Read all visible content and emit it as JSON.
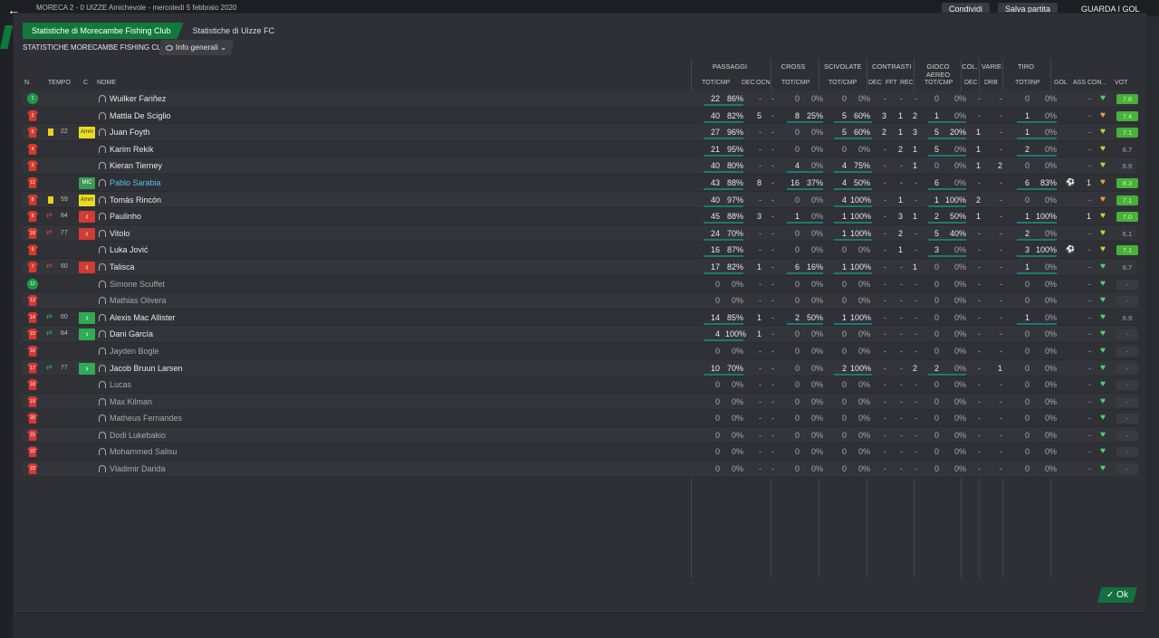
{
  "top": {
    "match_title": "MORECA  2 - 0  UIZZE  Amichevole - mercoledì 5 febbraio 2020",
    "share": "Condividi",
    "save": "Salva partita",
    "goals": "GUARDA I GOL"
  },
  "tabs": [
    "Statistiche di Morecambe Fishing Club",
    "Statistiche di Uizze FC"
  ],
  "subtitle": "STATISTICHE MORECAMBE FISHING CLUB",
  "dropdown": "Info generali",
  "groups": {
    "passaggi": "PASSAGGI",
    "cross": "CROSS",
    "scivolate": "SCIVOLATE",
    "contrasti": "CONTRASTI",
    "gioco_aereo": "GIOCO AEREO",
    "col": "COL.",
    "varie": "VARIE",
    "tiro": "TIRO"
  },
  "headers": {
    "n": "N.",
    "tempo": "TEMPO",
    "c": "C",
    "nome": "NOME",
    "tot_cmp1": "TOT/CMP",
    "dec": "DEC",
    "ocn": "OCN",
    "tot_cmp2": "TOT/CMP",
    "tot_cmp3": "TOT/CMP",
    "dec2": "DEC",
    "fft": "FFT",
    "rec": "REC",
    "tot_cmp4": "TOT/CMP",
    "dec3": "DEC",
    "drb": "DRB",
    "tot_inp": "TOT/INP",
    "gol": "GOL",
    "ass": "ASS",
    "con": "CON...",
    "vot": "VOT"
  },
  "players": [
    {
      "n": "1",
      "gk": true,
      "ev": "",
      "min": "",
      "badge": "",
      "name": "Wuilker Fariñez",
      "pa": "22",
      "pp": "86%",
      "dec": "-",
      "ocn": "-",
      "ct": "0",
      "cp": "0%",
      "st": "0",
      "sp": "0%",
      "cd": "-",
      "cf": "-",
      "cr": "-",
      "at": "0",
      "ap": "0%",
      "col": "-",
      "drb": "-",
      "tt": "0",
      "tp": "0%",
      "gol": "",
      "ass": "-",
      "heart": "g",
      "vot": "7.8",
      "vg": true
    },
    {
      "n": "2",
      "ev": "",
      "min": "",
      "badge": "",
      "name": "Mattia De Sciglio",
      "pa": "40",
      "pp": "82%",
      "dec": "5",
      "ocn": "-",
      "ct": "8",
      "cp": "25%",
      "st": "5",
      "sp": "60%",
      "cd": "3",
      "cf": "1",
      "cr": "2",
      "at": "1",
      "ap": "0%",
      "col": "-",
      "drb": "-",
      "tt": "1",
      "tp": "0%",
      "gol": "",
      "ass": "-",
      "heart": "o",
      "vot": "7.4",
      "vg": true
    },
    {
      "n": "6",
      "ev": "yellow",
      "min": "22",
      "badge": "Amm",
      "name": "Juan Foyth",
      "pa": "27",
      "pp": "96%",
      "dec": "-",
      "ocn": "-",
      "ct": "0",
      "cp": "0%",
      "st": "5",
      "sp": "60%",
      "cd": "2",
      "cf": "1",
      "cr": "3",
      "at": "5",
      "ap": "20%",
      "col": "1",
      "drb": "-",
      "tt": "1",
      "tp": "0%",
      "gol": "",
      "ass": "-",
      "heart": "y",
      "vot": "7.1",
      "vg": true
    },
    {
      "n": "4",
      "ev": "",
      "min": "",
      "badge": "",
      "name": "Karim Rekik",
      "pa": "21",
      "pp": "95%",
      "dec": "-",
      "ocn": "-",
      "ct": "0",
      "cp": "0%",
      "st": "0",
      "sp": "0%",
      "cd": "-",
      "cf": "2",
      "cr": "1",
      "at": "5",
      "ap": "0%",
      "col": "1",
      "drb": "-",
      "tt": "2",
      "tp": "0%",
      "gol": "",
      "ass": "-",
      "heart": "y",
      "vot": "6.7",
      "vg": false
    },
    {
      "n": "3",
      "ev": "",
      "min": "",
      "badge": "",
      "name": "Kieran Tierney",
      "pa": "40",
      "pp": "80%",
      "dec": "-",
      "ocn": "-",
      "ct": "4",
      "cp": "0%",
      "st": "4",
      "sp": "75%",
      "cd": "-",
      "cf": "-",
      "cr": "1",
      "at": "0",
      "ap": "0%",
      "col": "1",
      "drb": "2",
      "tt": "0",
      "tp": "0%",
      "gol": "",
      "ass": "-",
      "heart": "y",
      "vot": "6.9",
      "vg": false
    },
    {
      "n": "11",
      "ev": "",
      "min": "",
      "badge": "MIC",
      "name": "Pablo Sarabia",
      "hl": true,
      "pa": "43",
      "pp": "88%",
      "dec": "8",
      "ocn": "-",
      "ct": "16",
      "cp": "37%",
      "st": "4",
      "sp": "50%",
      "cd": "-",
      "cf": "-",
      "cr": "-",
      "at": "6",
      "ap": "0%",
      "col": "-",
      "drb": "-",
      "tt": "6",
      "tp": "83%",
      "gol": "ball",
      "ass": "1",
      "heart": "o",
      "vot": "8.3",
      "vg": true
    },
    {
      "n": "8",
      "ev": "yellow",
      "min": "59",
      "badge": "Amm",
      "name": "Tomás Rincón",
      "pa": "40",
      "pp": "97%",
      "dec": "-",
      "ocn": "-",
      "ct": "0",
      "cp": "0%",
      "st": "4",
      "sp": "100%",
      "cd": "-",
      "cf": "1",
      "cr": "-",
      "at": "1",
      "ap": "100%",
      "col": "2",
      "drb": "-",
      "tt": "0",
      "tp": "0%",
      "gol": "",
      "ass": "-",
      "heart": "o",
      "vot": "7.1",
      "vg": true
    },
    {
      "n": "8",
      "ev": "sub",
      "min": "84",
      "badge": "out",
      "name": "Paulinho",
      "pa": "45",
      "pp": "88%",
      "dec": "3",
      "ocn": "-",
      "ct": "1",
      "cp": "0%",
      "st": "1",
      "sp": "100%",
      "cd": "-",
      "cf": "3",
      "cr": "1",
      "at": "2",
      "ap": "50%",
      "col": "1",
      "drb": "-",
      "tt": "1",
      "tp": "100%",
      "gol": "",
      "ass": "1",
      "heart": "y",
      "vot": "7.0",
      "vg": true
    },
    {
      "n": "18",
      "ev": "sub",
      "min": "77",
      "badge": "out",
      "name": "Vitolo",
      "pa": "24",
      "pp": "70%",
      "dec": "-",
      "ocn": "-",
      "ct": "0",
      "cp": "0%",
      "st": "1",
      "sp": "100%",
      "cd": "-",
      "cf": "2",
      "cr": "-",
      "at": "5",
      "ap": "40%",
      "col": "-",
      "drb": "-",
      "tt": "2",
      "tp": "0%",
      "gol": "",
      "ass": "-",
      "heart": "y",
      "vot": "6.1",
      "vg": false
    },
    {
      "n": "9",
      "ev": "",
      "min": "",
      "badge": "",
      "name": "Luka Jović",
      "pa": "16",
      "pp": "87%",
      "dec": "-",
      "ocn": "-",
      "ct": "0",
      "cp": "0%",
      "st": "0",
      "sp": "0%",
      "cd": "-",
      "cf": "1",
      "cr": "-",
      "at": "3",
      "ap": "0%",
      "col": "-",
      "drb": "-",
      "tt": "3",
      "tp": "100%",
      "gol": "ball",
      "ass": "-",
      "heart": "y",
      "vot": "7.1",
      "vg": true
    },
    {
      "n": "7",
      "ev": "sub",
      "min": "60",
      "badge": "out",
      "name": "Talisca",
      "pa": "17",
      "pp": "82%",
      "dec": "1",
      "ocn": "-",
      "ct": "6",
      "cp": "16%",
      "st": "1",
      "sp": "100%",
      "cd": "-",
      "cf": "-",
      "cr": "1",
      "at": "0",
      "ap": "0%",
      "col": "-",
      "drb": "-",
      "tt": "1",
      "tp": "0%",
      "gol": "",
      "ass": "-",
      "heart": "g",
      "vot": "6.7",
      "vg": false
    },
    {
      "n": "12",
      "gk": true,
      "ev": "",
      "min": "",
      "badge": "",
      "name": "Simone Scuffet",
      "dim": true,
      "pa": "0",
      "pp": "0%",
      "dec": "-",
      "ocn": "-",
      "ct": "0",
      "cp": "0%",
      "st": "0",
      "sp": "0%",
      "cd": "-",
      "cf": "-",
      "cr": "-",
      "at": "0",
      "ap": "0%",
      "col": "-",
      "drb": "-",
      "tt": "0",
      "tp": "0%",
      "gol": "",
      "ass": "-",
      "heart": "g",
      "vot": "-",
      "vg": false
    },
    {
      "n": "13",
      "ev": "",
      "min": "",
      "badge": "",
      "name": "Mathias Olivera",
      "dim": true,
      "pa": "0",
      "pp": "0%",
      "dec": "-",
      "ocn": "-",
      "ct": "0",
      "cp": "0%",
      "st": "0",
      "sp": "0%",
      "cd": "-",
      "cf": "-",
      "cr": "-",
      "at": "0",
      "ap": "0%",
      "col": "-",
      "drb": "-",
      "tt": "0",
      "tp": "0%",
      "gol": "",
      "ass": "-",
      "heart": "g",
      "vot": "-",
      "vg": false
    },
    {
      "n": "14",
      "ev": "subin",
      "min": "60",
      "badge": "in",
      "name": "Alexis Mac Allister",
      "pa": "14",
      "pp": "85%",
      "dec": "1",
      "ocn": "-",
      "ct": "2",
      "cp": "50%",
      "st": "1",
      "sp": "100%",
      "cd": "-",
      "cf": "-",
      "cr": "-",
      "at": "0",
      "ap": "0%",
      "col": "-",
      "drb": "-",
      "tt": "1",
      "tp": "0%",
      "gol": "",
      "ass": "-",
      "heart": "g",
      "vot": "6.9",
      "vg": false
    },
    {
      "n": "15",
      "ev": "subin",
      "min": "84",
      "badge": "in",
      "name": "Dani García",
      "pa": "4",
      "pp": "100%",
      "dec": "1",
      "ocn": "-",
      "ct": "0",
      "cp": "0%",
      "st": "0",
      "sp": "0%",
      "cd": "-",
      "cf": "-",
      "cr": "-",
      "at": "0",
      "ap": "0%",
      "col": "-",
      "drb": "-",
      "tt": "0",
      "tp": "0%",
      "gol": "",
      "ass": "-",
      "heart": "g",
      "vot": "-",
      "vg": false
    },
    {
      "n": "16",
      "ev": "",
      "min": "",
      "badge": "",
      "name": "Jayden Bogle",
      "dim": true,
      "pa": "0",
      "pp": "0%",
      "dec": "-",
      "ocn": "-",
      "ct": "0",
      "cp": "0%",
      "st": "0",
      "sp": "0%",
      "cd": "-",
      "cf": "-",
      "cr": "-",
      "at": "0",
      "ap": "0%",
      "col": "-",
      "drb": "-",
      "tt": "0",
      "tp": "0%",
      "gol": "",
      "ass": "-",
      "heart": "g",
      "vot": "-",
      "vg": false
    },
    {
      "n": "17",
      "ev": "subin",
      "min": "77",
      "badge": "in",
      "name": "Jacob Bruun Larsen",
      "pa": "10",
      "pp": "70%",
      "dec": "-",
      "ocn": "-",
      "ct": "0",
      "cp": "0%",
      "st": "2",
      "sp": "100%",
      "cd": "-",
      "cf": "-",
      "cr": "2",
      "at": "2",
      "ap": "0%",
      "col": "-",
      "drb": "1",
      "tt": "0",
      "tp": "0%",
      "gol": "",
      "ass": "-",
      "heart": "g",
      "vot": "-",
      "vg": false
    },
    {
      "n": "18",
      "ev": "",
      "min": "",
      "badge": "",
      "name": "Lucas",
      "dim": true,
      "pa": "0",
      "pp": "0%",
      "dec": "-",
      "ocn": "-",
      "ct": "0",
      "cp": "0%",
      "st": "0",
      "sp": "0%",
      "cd": "-",
      "cf": "-",
      "cr": "-",
      "at": "0",
      "ap": "0%",
      "col": "-",
      "drb": "-",
      "tt": "0",
      "tp": "0%",
      "gol": "",
      "ass": "-",
      "heart": "g",
      "vot": "-",
      "vg": false
    },
    {
      "n": "19",
      "ev": "",
      "min": "",
      "badge": "",
      "name": "Max Kilman",
      "dim": true,
      "pa": "0",
      "pp": "0%",
      "dec": "-",
      "ocn": "-",
      "ct": "0",
      "cp": "0%",
      "st": "0",
      "sp": "0%",
      "cd": "-",
      "cf": "-",
      "cr": "-",
      "at": "0",
      "ap": "0%",
      "col": "-",
      "drb": "-",
      "tt": "0",
      "tp": "0%",
      "gol": "",
      "ass": "-",
      "heart": "g",
      "vot": "-",
      "vg": false
    },
    {
      "n": "20",
      "ev": "",
      "min": "",
      "badge": "",
      "name": "Matheus Fernandes",
      "dim": true,
      "pa": "0",
      "pp": "0%",
      "dec": "-",
      "ocn": "-",
      "ct": "0",
      "cp": "0%",
      "st": "0",
      "sp": "0%",
      "cd": "-",
      "cf": "-",
      "cr": "-",
      "at": "0",
      "ap": "0%",
      "col": "-",
      "drb": "-",
      "tt": "0",
      "tp": "0%",
      "gol": "",
      "ass": "-",
      "heart": "g",
      "vot": "-",
      "vg": false
    },
    {
      "n": "21",
      "ev": "",
      "min": "",
      "badge": "",
      "name": "Dodi Lukebakio",
      "dim": true,
      "pa": "0",
      "pp": "0%",
      "dec": "-",
      "ocn": "-",
      "ct": "0",
      "cp": "0%",
      "st": "0",
      "sp": "0%",
      "cd": "-",
      "cf": "-",
      "cr": "-",
      "at": "0",
      "ap": "0%",
      "col": "-",
      "drb": "-",
      "tt": "0",
      "tp": "0%",
      "gol": "",
      "ass": "-",
      "heart": "g",
      "vot": "-",
      "vg": false
    },
    {
      "n": "22",
      "ev": "",
      "min": "",
      "badge": "",
      "name": "Mohammed Salisu",
      "dim": true,
      "pa": "0",
      "pp": "0%",
      "dec": "-",
      "ocn": "-",
      "ct": "0",
      "cp": "0%",
      "st": "0",
      "sp": "0%",
      "cd": "-",
      "cf": "-",
      "cr": "-",
      "at": "0",
      "ap": "0%",
      "col": "-",
      "drb": "-",
      "tt": "0",
      "tp": "0%",
      "gol": "",
      "ass": "-",
      "heart": "g",
      "vot": "-",
      "vg": false
    },
    {
      "n": "23",
      "ev": "",
      "min": "",
      "badge": "",
      "name": "Vladimir Darida",
      "dim": true,
      "pa": "0",
      "pp": "0%",
      "dec": "-",
      "ocn": "-",
      "ct": "0",
      "cp": "0%",
      "st": "0",
      "sp": "0%",
      "cd": "-",
      "cf": "-",
      "cr": "-",
      "at": "0",
      "ap": "0%",
      "col": "-",
      "drb": "-",
      "tt": "0",
      "tp": "0%",
      "gol": "",
      "ass": "-",
      "heart": "g",
      "vot": "-",
      "vg": false
    }
  ],
  "ok": "Ok"
}
